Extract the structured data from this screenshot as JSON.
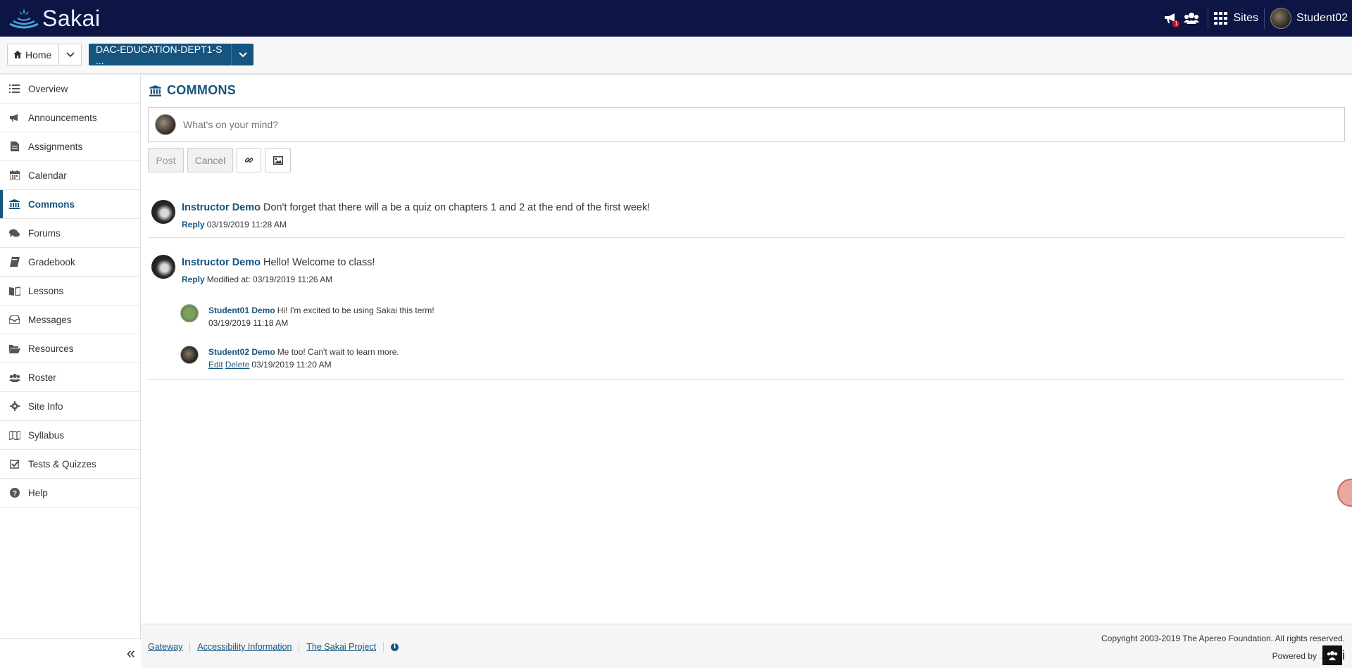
{
  "header": {
    "logo_text": "Sakai",
    "notification_count": "1",
    "sites_label": "Sites",
    "user_name": "Student02"
  },
  "sitebar": {
    "home_label": "Home",
    "site_label": "DAC-EDUCATION-DEPT1-S ..."
  },
  "toolmenu": {
    "items": [
      {
        "label": "Overview",
        "icon": "list-icon"
      },
      {
        "label": "Announcements",
        "icon": "bullhorn-icon"
      },
      {
        "label": "Assignments",
        "icon": "file-icon"
      },
      {
        "label": "Calendar",
        "icon": "calendar-icon"
      },
      {
        "label": "Commons",
        "icon": "institution-icon"
      },
      {
        "label": "Forums",
        "icon": "comments-icon"
      },
      {
        "label": "Gradebook",
        "icon": "book-icon"
      },
      {
        "label": "Lessons",
        "icon": "open-book-icon"
      },
      {
        "label": "Messages",
        "icon": "inbox-icon"
      },
      {
        "label": "Resources",
        "icon": "folder-open-icon"
      },
      {
        "label": "Roster",
        "icon": "users-icon"
      },
      {
        "label": "Site Info",
        "icon": "gear-icon"
      },
      {
        "label": "Syllabus",
        "icon": "map-icon"
      },
      {
        "label": "Tests & Quizzes",
        "icon": "check-square-icon"
      },
      {
        "label": "Help",
        "icon": "question-circle-icon"
      }
    ],
    "active_index": 4,
    "collapse_label": "«"
  },
  "main": {
    "title": "COMMONS",
    "composer_placeholder": "What's on your mind?",
    "post_button": "Post",
    "cancel_button": "Cancel",
    "posts": [
      {
        "author": "Instructor Demo",
        "text": "Don't forget that there will a be a quiz on chapters 1 and 2 at the end of the first week!",
        "reply_label": "Reply",
        "meta": "03/19/2019 11:28 AM"
      },
      {
        "author": "Instructor Demo",
        "text": "Hello! Welcome to class!",
        "reply_label": "Reply",
        "meta": "Modified at: 03/19/2019 11:26 AM",
        "comments": [
          {
            "author": "Student01 Demo",
            "text": "Hi! I'm excited to be using Sakai this term!",
            "meta": "03/19/2019 11:18 AM"
          },
          {
            "author": "Student02 Demo",
            "text": "Me too! Can't wait to learn more.",
            "edit_label": "Edit",
            "delete_label": "Delete",
            "meta": "03/19/2019 11:20 AM"
          }
        ]
      }
    ]
  },
  "footer": {
    "links": [
      "Gateway",
      "Accessibility Information",
      "The Sakai Project"
    ],
    "info_label": "i",
    "copyright": "Copyright 2003-2019 The Apereo Foundation. All rights reserved.",
    "powered_by": "Powered by",
    "powered_logo_text": "ai"
  },
  "colors": {
    "header_bg": "#0c1543",
    "accent": "#15557f",
    "badge": "#c8102e"
  }
}
